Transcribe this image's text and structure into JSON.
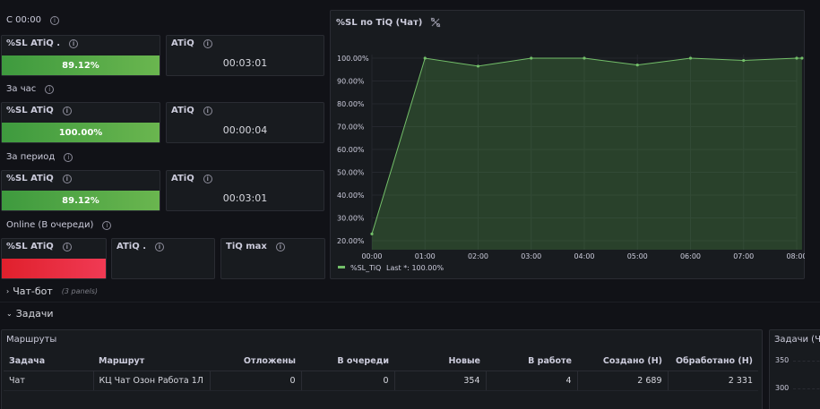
{
  "section_since": {
    "label": "С 00:00"
  },
  "section_hour": {
    "label": "За час"
  },
  "section_period": {
    "label": "За период"
  },
  "section_online": {
    "label": "Online (В очереди)"
  },
  "stat_since_sl": {
    "title": "%SL ATiQ .",
    "value": "89.12%"
  },
  "stat_since_atiq": {
    "title": "ATiQ",
    "value": "00:03:01"
  },
  "stat_hour_sl": {
    "title": "%SL ATiQ",
    "value": "100.00%"
  },
  "stat_hour_atiq": {
    "title": "ATiQ",
    "value": "00:00:04"
  },
  "stat_period_sl": {
    "title": "%SL ATiQ",
    "value": "89.12%"
  },
  "stat_period_atiq": {
    "title": "ATiQ",
    "value": "00:03:01"
  },
  "stat_online_sl": {
    "title": "%SL ATiQ"
  },
  "stat_online_atiq": {
    "title": "ATiQ ."
  },
  "stat_online_tiqmax": {
    "title": "TiQ max"
  },
  "chart_panel": {
    "title": "%SL по TiQ (Чат)"
  },
  "colors": {
    "green_bar": "#56a64b",
    "red_bar": "#e02f44",
    "line": "#73bf69",
    "background": "#111217",
    "panel": "#181b1f"
  },
  "chart_data": {
    "type": "area",
    "title": "%SL по TiQ (Чат)",
    "x": [
      "00:00",
      "01:00",
      "02:00",
      "03:00",
      "04:00",
      "05:00",
      "06:00",
      "07:00",
      "08:00"
    ],
    "series": [
      {
        "name": "%SL_TiQ",
        "values": [
          23,
          100,
          96.5,
          100,
          100,
          97,
          100,
          99,
          100,
          100
        ]
      }
    ],
    "x_points": [
      0,
      1,
      2,
      3,
      4,
      5,
      6,
      7,
      8,
      8.1
    ],
    "y_ticks": [
      "20.00%",
      "30.00%",
      "40.00%",
      "50.00%",
      "60.00%",
      "70.00%",
      "80.00%",
      "90.00%",
      "100.00%"
    ],
    "ylim": [
      20,
      100
    ],
    "grid": true,
    "legend": {
      "label": "%SL_TiQ",
      "stat": "Last *: 100.00%",
      "placement": "bottom-left"
    }
  },
  "rows": {
    "chatbot": {
      "label": "Чат-бот",
      "sub": "(3 panels)"
    },
    "tasks": {
      "label": "Задачи"
    }
  },
  "routes_panel": {
    "title": "Маршруты",
    "columns": [
      "Задача",
      "Маршрут",
      "Отложены",
      "В очереди",
      "Новые",
      "В работе",
      "Создано (Н)",
      "Обработано (Н)"
    ],
    "rows": [
      [
        "Чат",
        "КЦ Чат Озон Работа 1Л",
        "0",
        "0",
        "354",
        "4",
        "2 689",
        "2 331"
      ]
    ]
  },
  "tasks_panel": {
    "title": "Задачи (Ча",
    "y_ticks": [
      "350",
      "300"
    ]
  }
}
